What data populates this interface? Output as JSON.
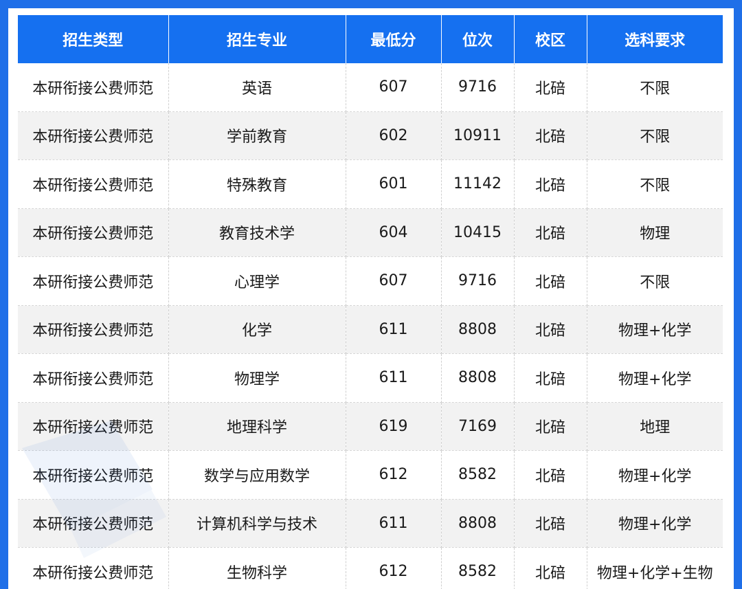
{
  "table": {
    "columns": [
      "招生类型",
      "招生专业",
      "最低分",
      "位次",
      "校区",
      "选科要求"
    ],
    "rows": [
      [
        "本研衔接公费师范",
        "英语",
        "607",
        "9716",
        "北碚",
        "不限"
      ],
      [
        "本研衔接公费师范",
        "学前教育",
        "602",
        "10911",
        "北碚",
        "不限"
      ],
      [
        "本研衔接公费师范",
        "特殊教育",
        "601",
        "11142",
        "北碚",
        "不限"
      ],
      [
        "本研衔接公费师范",
        "教育技术学",
        "604",
        "10415",
        "北碚",
        "物理"
      ],
      [
        "本研衔接公费师范",
        "心理学",
        "607",
        "9716",
        "北碚",
        "不限"
      ],
      [
        "本研衔接公费师范",
        "化学",
        "611",
        "8808",
        "北碚",
        "物理+化学"
      ],
      [
        "本研衔接公费师范",
        "物理学",
        "611",
        "8808",
        "北碚",
        "物理+化学"
      ],
      [
        "本研衔接公费师范",
        "地理科学",
        "619",
        "7169",
        "北碚",
        "地理"
      ],
      [
        "本研衔接公费师范",
        "数学与应用数学",
        "612",
        "8582",
        "北碚",
        "物理+化学"
      ],
      [
        "本研衔接公费师范",
        "计算机科学与技术",
        "611",
        "8808",
        "北碚",
        "物理+化学"
      ],
      [
        "本研衔接公费师范",
        "生物科学",
        "612",
        "8582",
        "北碚",
        "物理+化学+生物"
      ]
    ]
  },
  "colors": {
    "header_bg": "#1570f0",
    "frame": "#1f6fe8",
    "row_alt": "#f2f2f2"
  }
}
